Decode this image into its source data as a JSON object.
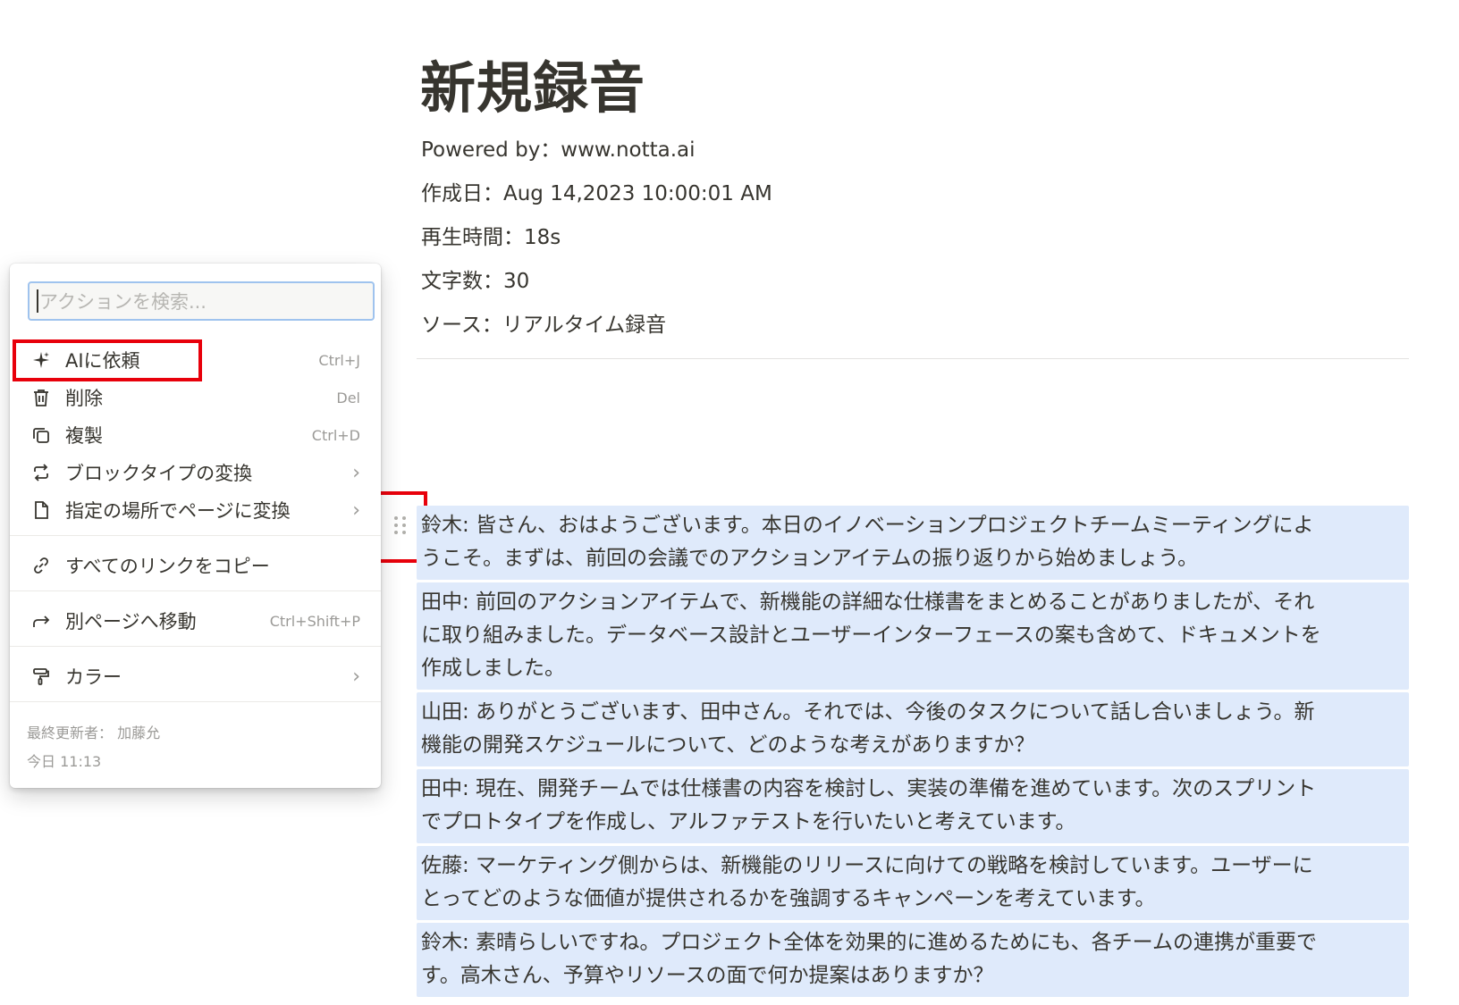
{
  "document": {
    "title": "新規録音",
    "meta": [
      "Powered by：www.notta.ai",
      "作成日：Aug 14,2023 10:00:01 AM",
      "再生時間：18s",
      "文字数：30",
      "ソース：リアルタイム録音"
    ],
    "transcript": [
      {
        "lines": [
          "鈴木: 皆さん、おはようございます。本日のイノベーションプロジェクトチームミーティングによ",
          "うこそ。まずは、前回の会議でのアクションアイテムの振り返りから始めましょう。"
        ]
      },
      {
        "lines": [
          "田中: 前回のアクションアイテムで、新機能の詳細な仕様書をまとめることがありましたが、それ",
          "に取り組みました。データベース設計とユーザーインターフェースの案も含めて、ドキュメントを",
          "作成しました。"
        ]
      },
      {
        "lines": [
          "山田: ありがとうございます、田中さん。それでは、今後のタスクについて話し合いましょう。新",
          "機能の開発スケジュールについて、どのような考えがありますか？"
        ]
      },
      {
        "lines": [
          "田中: 現在、開発チームでは仕様書の内容を検討し、実装の準備を進めています。次のスプリント",
          "でプロトタイプを作成し、アルファテストを行いたいと考えています。"
        ]
      },
      {
        "lines": [
          "佐藤: マーケティング側からは、新機能のリリースに向けての戦略を検討しています。ユーザーに",
          "とってどのような価値が提供されるかを強調するキャンペーンを考えています。"
        ]
      },
      {
        "lines": [
          "鈴木: 素晴らしいですね。プロジェクト全体を効果的に進めるためにも、各チームの連携が重要で",
          "す。高木さん、予算やリソースの面で何か提案はありますか？"
        ]
      }
    ]
  },
  "menu": {
    "search_placeholder": "アクションを検索...",
    "items": [
      {
        "label": "AIに依頼",
        "shortcut": "Ctrl+J",
        "icon": "sparkle-icon"
      },
      {
        "label": "削除",
        "shortcut": "Del",
        "icon": "trash-icon"
      },
      {
        "label": "複製",
        "shortcut": "Ctrl+D",
        "icon": "duplicate-icon"
      },
      {
        "label": "ブロックタイプの変換",
        "shortcut": "›",
        "icon": "turn-into-icon"
      },
      {
        "label": "指定の場所でページに変換",
        "shortcut": "›",
        "icon": "page-icon"
      },
      {
        "label": "すべてのリンクをコピー",
        "shortcut": "",
        "icon": "link-icon"
      },
      {
        "label": "別ページへ移動",
        "shortcut": "Ctrl+Shift+P",
        "icon": "move-arrow-icon"
      },
      {
        "label": "カラー",
        "shortcut": "›",
        "icon": "paint-roller-icon"
      }
    ],
    "footer": {
      "last_edited": "最終更新者： 加藤允",
      "time": "今日 11:13"
    }
  },
  "colors": {
    "highlight_box": "#e8000b",
    "block_background": "#dfeafb"
  }
}
